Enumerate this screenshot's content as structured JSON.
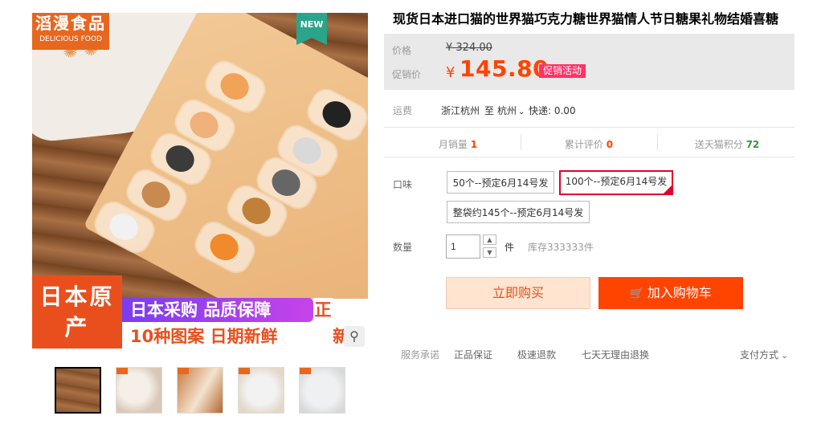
{
  "gallery": {
    "brand_logo_cn": "滔漫食品",
    "brand_logo_en": "DELICIOUS FOOD",
    "new_flag": "NEW",
    "banner_left": "日本原产",
    "banner_tag1": "日本采购 品质保障",
    "banner_tag1_tail": "正",
    "banner_tag2": "10种图案 日期新鲜",
    "banner_tag2_tail": "新",
    "thumbnail_count": 5
  },
  "product": {
    "title": "现货日本进口猫的世界猫巧克力糖世界猫情人节日糖果礼物结婚喜糖"
  },
  "price": {
    "label": "价格",
    "original": "¥ 324.00",
    "promo_label": "促销价",
    "currency": "¥",
    "promo_value": "145.80",
    "promo_badge": "促销活动"
  },
  "shipping": {
    "label": "运费",
    "from": "浙江杭州",
    "to_word": "至",
    "to": "杭州",
    "express": "快递: 0.00"
  },
  "stats": {
    "monthly_label": "月销量",
    "monthly_value": "1",
    "reviews_label": "累计评价",
    "reviews_value": "0",
    "points_label": "送天猫积分",
    "points_value": "72"
  },
  "flavor": {
    "label": "口味",
    "options": [
      "50个--预定6月14号发",
      "100个--预定6月14号发",
      "整袋约145个--预定6月14号发"
    ],
    "selected": "100个--预定6月14号发"
  },
  "quantity": {
    "label": "数量",
    "value": "1",
    "unit": "件",
    "stock": "库存333333件"
  },
  "actions": {
    "buy_now": "立即购买",
    "add_to_cart": "加入购物车"
  },
  "service": {
    "label": "服务承诺",
    "items": [
      "正品保证",
      "极速退款",
      "七天无理由退换"
    ],
    "payment": "支付方式"
  },
  "colors": {
    "accent": "#ff4400",
    "badge": "#ff3366",
    "selected_border": "#e4002b",
    "points_green": "#339933"
  }
}
